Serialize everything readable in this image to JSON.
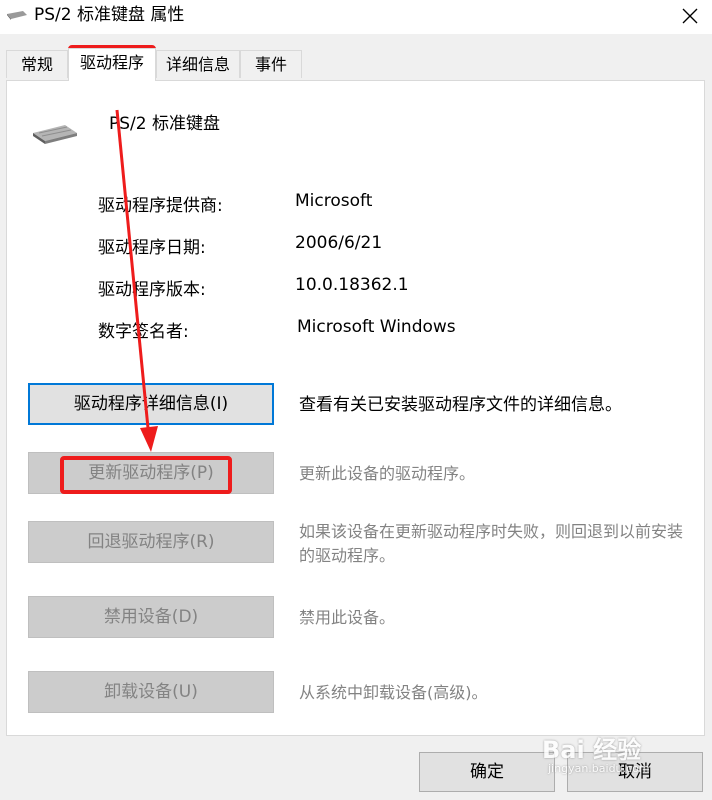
{
  "window": {
    "title": "PS/2 标准键盘 属性",
    "close_icon": "close-icon"
  },
  "tabs": [
    {
      "label": "常规",
      "active": false
    },
    {
      "label": "驱动程序",
      "active": true
    },
    {
      "label": "详细信息",
      "active": false
    },
    {
      "label": "事件",
      "active": false
    }
  ],
  "device": {
    "name": "PS/2 标准键盘",
    "icon": "keyboard-icon"
  },
  "driver_info": {
    "provider_label": "驱动程序提供商:",
    "provider_value": "Microsoft",
    "date_label": "驱动程序日期:",
    "date_value": "2006/6/21",
    "version_label": "驱动程序版本:",
    "version_value": "10.0.18362.1",
    "signer_label": "数字签名者:",
    "signer_value": "Microsoft Windows"
  },
  "actions": [
    {
      "label": "驱动程序详细信息(I)",
      "description": "查看有关已安装驱动程序文件的详细信息。",
      "enabled": true
    },
    {
      "label": "更新驱动程序(P)",
      "description": "更新此设备的驱动程序。",
      "enabled": false
    },
    {
      "label": "回退驱动程序(R)",
      "description": "如果该设备在更新驱动程序时失败，则回退到以前安装的驱动程序。",
      "enabled": false
    },
    {
      "label": "禁用设备(D)",
      "description": "禁用此设备。",
      "enabled": false
    },
    {
      "label": "卸载设备(U)",
      "description": "从系统中卸载设备(高级)。",
      "enabled": false
    }
  ],
  "footer": {
    "ok_label": "确定",
    "cancel_label": "取消"
  },
  "annotation_color": "#ee1c1c",
  "watermark": {
    "logo": "Bai 经验",
    "url": "jingyan.baidu.com"
  }
}
